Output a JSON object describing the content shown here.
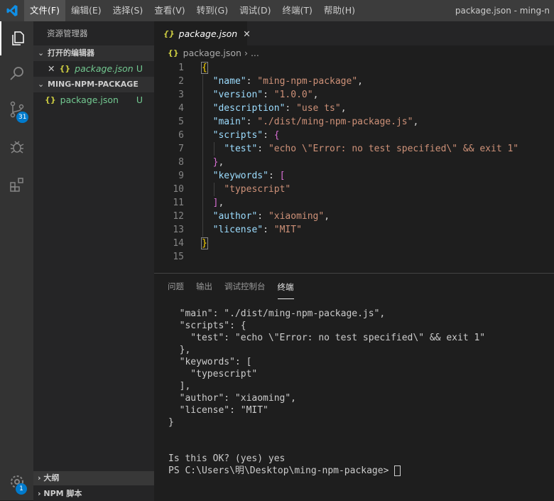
{
  "titlebar": {
    "menus": [
      "文件(F)",
      "编辑(E)",
      "选择(S)",
      "查看(V)",
      "转到(G)",
      "调试(D)",
      "终端(T)",
      "帮助(H)"
    ],
    "title": "package.json - ming-n"
  },
  "activity": {
    "scm_badge": "31",
    "settings_badge": "1"
  },
  "sidebar": {
    "title": "资源管理器",
    "open_editors": "打开的编辑器",
    "open_file": "package.json",
    "open_file_status": "U",
    "project": "MING-NPM-PACKAGE",
    "file": "package.json",
    "file_status": "U",
    "outline": "大纲",
    "npm": "NPM 脚本"
  },
  "editor": {
    "tab": "package.json",
    "breadcrumb": "package.json",
    "breadcrumb_more": "...",
    "lines": [
      [
        [
          "{",
          "b1"
        ]
      ],
      [
        [
          "  ",
          "p"
        ],
        [
          "\"name\"",
          "k"
        ],
        [
          ": ",
          "p"
        ],
        [
          "\"ming-npm-package\"",
          "s"
        ],
        [
          ",",
          "p"
        ]
      ],
      [
        [
          "  ",
          "p"
        ],
        [
          "\"version\"",
          "k"
        ],
        [
          ": ",
          "p"
        ],
        [
          "\"1.0.0\"",
          "s"
        ],
        [
          ",",
          "p"
        ]
      ],
      [
        [
          "  ",
          "p"
        ],
        [
          "\"description\"",
          "k"
        ],
        [
          ": ",
          "p"
        ],
        [
          "\"use ts\"",
          "s"
        ],
        [
          ",",
          "p"
        ]
      ],
      [
        [
          "  ",
          "p"
        ],
        [
          "\"main\"",
          "k"
        ],
        [
          ": ",
          "p"
        ],
        [
          "\"./dist/ming-npm-package.js\"",
          "s"
        ],
        [
          ",",
          "p"
        ]
      ],
      [
        [
          "  ",
          "p"
        ],
        [
          "\"scripts\"",
          "k"
        ],
        [
          ": ",
          "p"
        ],
        [
          "{",
          "b2"
        ]
      ],
      [
        [
          "    ",
          "p"
        ],
        [
          "\"test\"",
          "k"
        ],
        [
          ": ",
          "p"
        ],
        [
          "\"echo \\\"Error: no test specified\\\" && exit 1\"",
          "s"
        ]
      ],
      [
        [
          "  ",
          "p"
        ],
        [
          "}",
          "b2"
        ],
        [
          ",",
          "p"
        ]
      ],
      [
        [
          "  ",
          "p"
        ],
        [
          "\"keywords\"",
          "k"
        ],
        [
          ": ",
          "p"
        ],
        [
          "[",
          "b2"
        ]
      ],
      [
        [
          "    ",
          "p"
        ],
        [
          "\"typescript\"",
          "s"
        ]
      ],
      [
        [
          "  ",
          "p"
        ],
        [
          "]",
          "b2"
        ],
        [
          ",",
          "p"
        ]
      ],
      [
        [
          "  ",
          "p"
        ],
        [
          "\"author\"",
          "k"
        ],
        [
          ": ",
          "p"
        ],
        [
          "\"xiaoming\"",
          "s"
        ],
        [
          ",",
          "p"
        ]
      ],
      [
        [
          "  ",
          "p"
        ],
        [
          "\"license\"",
          "k"
        ],
        [
          ": ",
          "p"
        ],
        [
          "\"MIT\"",
          "s"
        ]
      ],
      [
        [
          "}",
          "b1"
        ]
      ],
      []
    ]
  },
  "panel": {
    "tabs": [
      "问题",
      "输出",
      "调试控制台",
      "终端"
    ],
    "terminal": [
      "  \"main\": \"./dist/ming-npm-package.js\",",
      "  \"scripts\": {",
      "    \"test\": \"echo \\\"Error: no test specified\\\" && exit 1\"",
      "  },",
      "  \"keywords\": [",
      "    \"typescript\"",
      "  ],",
      "  \"author\": \"xiaoming\",",
      "  \"license\": \"MIT\"",
      "}",
      "",
      "",
      "Is this OK? (yes) yes",
      "PS C:\\Users\\明\\Desktop\\ming-npm-package> "
    ]
  }
}
